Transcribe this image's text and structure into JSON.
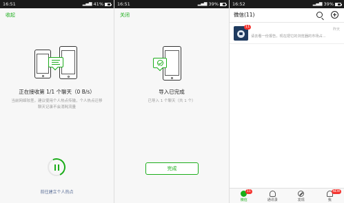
{
  "panel1": {
    "status": {
      "time": "16:51",
      "battery": "41%"
    },
    "top_link": "收起",
    "title": "正在接收第 1/1 个聊天（0 B/s）",
    "hint_lines": [
      "当前网络较差，建议使用个人热点传输，个人热点迁移",
      "聊天记录不会消耗流量"
    ],
    "bottom_link": "前往建立个人热点"
  },
  "panel2": {
    "status": {
      "time": "16:51",
      "battery": "39%"
    },
    "top_link": "关闭",
    "title": "导入已完成",
    "sub": "已导入 1 个聊天（共 1 个）",
    "done_button": "完成"
  },
  "panel3": {
    "status": {
      "time": "16:52",
      "battery": "39%"
    },
    "header_title": "微信(11)",
    "chat": {
      "badge": "11",
      "time": "昨天",
      "preview": "请去看一份报告，现在把它的浏览器的市场占..."
    },
    "tabs": [
      {
        "label": "微信",
        "badge": "11"
      },
      {
        "label": "通讯录",
        "badge": ""
      },
      {
        "label": "发现",
        "badge": ""
      },
      {
        "label": "我",
        "badge": "NEW"
      }
    ]
  },
  "colors": {
    "accent": "#1aad19",
    "badge": "#f43530",
    "link": "#576b95"
  }
}
